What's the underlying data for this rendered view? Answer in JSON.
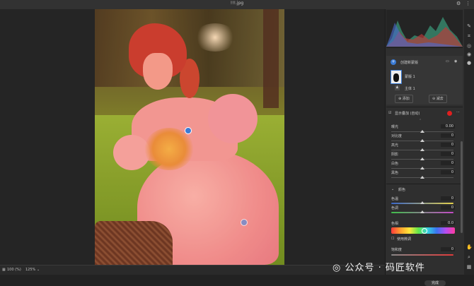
{
  "window": {
    "title": "!!!.jpg"
  },
  "status": {
    "zoom_fit": "100 (%)",
    "zoom_pct": "125%"
  },
  "mask_panel": {
    "title": "创建新蒙版",
    "mask_name": "蒙版 1",
    "select_name": "主体 1",
    "add_label": "添加",
    "subtract_label": "减去"
  },
  "adjust": {
    "header": "显示叠加 (自动)",
    "light_rows": [
      {
        "label": "曝光",
        "value": "0.00",
        "pos": 0.5
      },
      {
        "label": "对比度",
        "value": "0",
        "pos": 0.5
      },
      {
        "label": "高光",
        "value": "0",
        "pos": 0.5
      },
      {
        "label": "阴影",
        "value": "0",
        "pos": 0.5
      },
      {
        "label": "白色",
        "value": "0",
        "pos": 0.5
      },
      {
        "label": "黑色",
        "value": "0",
        "pos": 0.5
      }
    ],
    "color_section": "颜色",
    "temp_label": "色温",
    "temp_value": "0",
    "tint_label": "色调",
    "tint_value": "0",
    "hue_label": "色相",
    "hue_value": "0.0",
    "fine_label": "使用微调",
    "sat_label": "饱和度",
    "sat_value": "0"
  },
  "watermark": {
    "text": "公众号 · 码匠软件"
  },
  "buttons": {
    "done": "完成"
  },
  "colors": {
    "accent": "#3a7bd5",
    "mask_overlay": "#ff2828",
    "swatch": "#e01f1f"
  }
}
